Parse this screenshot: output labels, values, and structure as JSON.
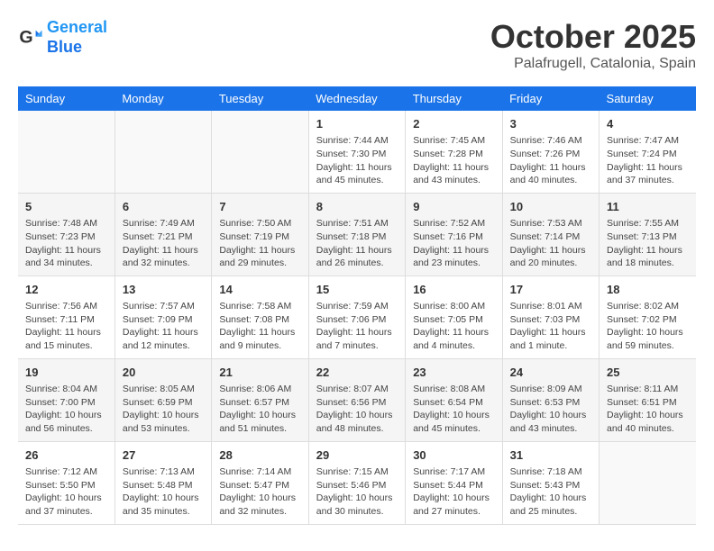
{
  "header": {
    "logo_line1": "General",
    "logo_line2": "Blue",
    "month": "October 2025",
    "location": "Palafrugell, Catalonia, Spain"
  },
  "weekdays": [
    "Sunday",
    "Monday",
    "Tuesday",
    "Wednesday",
    "Thursday",
    "Friday",
    "Saturday"
  ],
  "weeks": [
    [
      {
        "day": "",
        "info": ""
      },
      {
        "day": "",
        "info": ""
      },
      {
        "day": "",
        "info": ""
      },
      {
        "day": "1",
        "info": "Sunrise: 7:44 AM\nSunset: 7:30 PM\nDaylight: 11 hours and 45 minutes."
      },
      {
        "day": "2",
        "info": "Sunrise: 7:45 AM\nSunset: 7:28 PM\nDaylight: 11 hours and 43 minutes."
      },
      {
        "day": "3",
        "info": "Sunrise: 7:46 AM\nSunset: 7:26 PM\nDaylight: 11 hours and 40 minutes."
      },
      {
        "day": "4",
        "info": "Sunrise: 7:47 AM\nSunset: 7:24 PM\nDaylight: 11 hours and 37 minutes."
      }
    ],
    [
      {
        "day": "5",
        "info": "Sunrise: 7:48 AM\nSunset: 7:23 PM\nDaylight: 11 hours and 34 minutes."
      },
      {
        "day": "6",
        "info": "Sunrise: 7:49 AM\nSunset: 7:21 PM\nDaylight: 11 hours and 32 minutes."
      },
      {
        "day": "7",
        "info": "Sunrise: 7:50 AM\nSunset: 7:19 PM\nDaylight: 11 hours and 29 minutes."
      },
      {
        "day": "8",
        "info": "Sunrise: 7:51 AM\nSunset: 7:18 PM\nDaylight: 11 hours and 26 minutes."
      },
      {
        "day": "9",
        "info": "Sunrise: 7:52 AM\nSunset: 7:16 PM\nDaylight: 11 hours and 23 minutes."
      },
      {
        "day": "10",
        "info": "Sunrise: 7:53 AM\nSunset: 7:14 PM\nDaylight: 11 hours and 20 minutes."
      },
      {
        "day": "11",
        "info": "Sunrise: 7:55 AM\nSunset: 7:13 PM\nDaylight: 11 hours and 18 minutes."
      }
    ],
    [
      {
        "day": "12",
        "info": "Sunrise: 7:56 AM\nSunset: 7:11 PM\nDaylight: 11 hours and 15 minutes."
      },
      {
        "day": "13",
        "info": "Sunrise: 7:57 AM\nSunset: 7:09 PM\nDaylight: 11 hours and 12 minutes."
      },
      {
        "day": "14",
        "info": "Sunrise: 7:58 AM\nSunset: 7:08 PM\nDaylight: 11 hours and 9 minutes."
      },
      {
        "day": "15",
        "info": "Sunrise: 7:59 AM\nSunset: 7:06 PM\nDaylight: 11 hours and 7 minutes."
      },
      {
        "day": "16",
        "info": "Sunrise: 8:00 AM\nSunset: 7:05 PM\nDaylight: 11 hours and 4 minutes."
      },
      {
        "day": "17",
        "info": "Sunrise: 8:01 AM\nSunset: 7:03 PM\nDaylight: 11 hours and 1 minute."
      },
      {
        "day": "18",
        "info": "Sunrise: 8:02 AM\nSunset: 7:02 PM\nDaylight: 10 hours and 59 minutes."
      }
    ],
    [
      {
        "day": "19",
        "info": "Sunrise: 8:04 AM\nSunset: 7:00 PM\nDaylight: 10 hours and 56 minutes."
      },
      {
        "day": "20",
        "info": "Sunrise: 8:05 AM\nSunset: 6:59 PM\nDaylight: 10 hours and 53 minutes."
      },
      {
        "day": "21",
        "info": "Sunrise: 8:06 AM\nSunset: 6:57 PM\nDaylight: 10 hours and 51 minutes."
      },
      {
        "day": "22",
        "info": "Sunrise: 8:07 AM\nSunset: 6:56 PM\nDaylight: 10 hours and 48 minutes."
      },
      {
        "day": "23",
        "info": "Sunrise: 8:08 AM\nSunset: 6:54 PM\nDaylight: 10 hours and 45 minutes."
      },
      {
        "day": "24",
        "info": "Sunrise: 8:09 AM\nSunset: 6:53 PM\nDaylight: 10 hours and 43 minutes."
      },
      {
        "day": "25",
        "info": "Sunrise: 8:11 AM\nSunset: 6:51 PM\nDaylight: 10 hours and 40 minutes."
      }
    ],
    [
      {
        "day": "26",
        "info": "Sunrise: 7:12 AM\nSunset: 5:50 PM\nDaylight: 10 hours and 37 minutes."
      },
      {
        "day": "27",
        "info": "Sunrise: 7:13 AM\nSunset: 5:48 PM\nDaylight: 10 hours and 35 minutes."
      },
      {
        "day": "28",
        "info": "Sunrise: 7:14 AM\nSunset: 5:47 PM\nDaylight: 10 hours and 32 minutes."
      },
      {
        "day": "29",
        "info": "Sunrise: 7:15 AM\nSunset: 5:46 PM\nDaylight: 10 hours and 30 minutes."
      },
      {
        "day": "30",
        "info": "Sunrise: 7:17 AM\nSunset: 5:44 PM\nDaylight: 10 hours and 27 minutes."
      },
      {
        "day": "31",
        "info": "Sunrise: 7:18 AM\nSunset: 5:43 PM\nDaylight: 10 hours and 25 minutes."
      },
      {
        "day": "",
        "info": ""
      }
    ]
  ]
}
